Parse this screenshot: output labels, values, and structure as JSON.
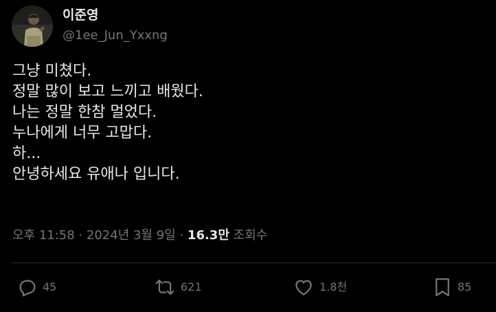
{
  "author": {
    "name": "이준영",
    "handle": "@1ee_Jun_Yxxng"
  },
  "tweet": {
    "lines": [
      "그냥 미쳤다.",
      "정말 많이 보고 느끼고 배웠다.",
      "나는 정말 한참 멀었다.",
      "누나에게 너무 고맙다.",
      "하...",
      "안녕하세요 유애나 입니다."
    ]
  },
  "meta": {
    "timestamp": "오후 11:58 · 2024년 3월 9일",
    "separator": "·",
    "views_count": "16.3만",
    "views_label": "조회수"
  },
  "actions": {
    "reply": {
      "icon": "reply-icon",
      "count": "45"
    },
    "retweet": {
      "icon": "retweet-icon",
      "count": "621"
    },
    "like": {
      "icon": "heart-icon",
      "count": "1.8천"
    },
    "bookmark": {
      "icon": "bookmark-icon",
      "count": "85"
    }
  },
  "colors": {
    "background": "#000000",
    "text_primary": "#e7e9ea",
    "text_secondary": "#71767b",
    "divider": "#2f3336"
  }
}
